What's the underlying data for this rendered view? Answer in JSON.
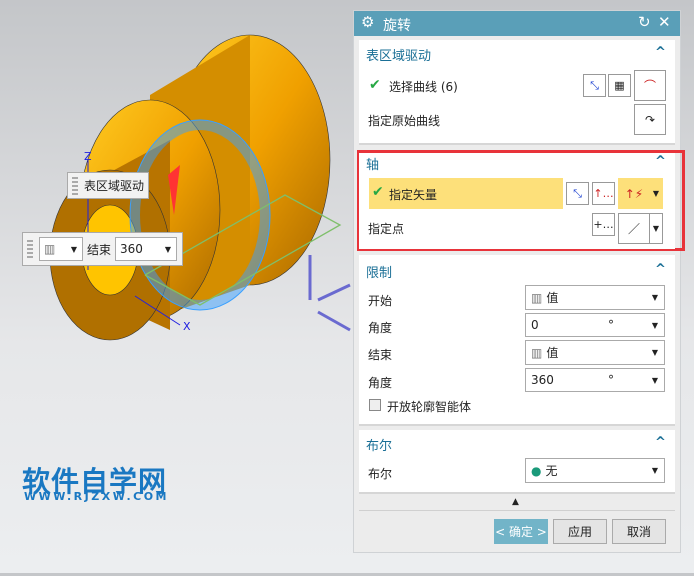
{
  "viewport": {
    "axis_labels": {
      "z": "Z",
      "x": "X"
    },
    "tooltip_label": "表区域驱动",
    "end_toolbar": {
      "label": "结束",
      "value": "360"
    },
    "watermark": {
      "title": "软件自学网",
      "url": "WWW.RJZXW.COM"
    }
  },
  "dialog": {
    "title": "旋转",
    "sections": {
      "region": {
        "title": "表区域驱动",
        "select_curve": "选择曲线 (6)",
        "origin_curve": "指定原始曲线"
      },
      "axis": {
        "title": "轴",
        "vector": "指定矢量",
        "point": "指定点"
      },
      "limits": {
        "title": "限制",
        "start_label": "开始",
        "start_value": "值",
        "angle1_label": "角度",
        "angle1_value": "0",
        "end_label": "结束",
        "end_value": "值",
        "angle2_label": "角度",
        "angle2_value": "360",
        "unit": "°",
        "open_profile": "开放轮廓智能体"
      },
      "boolean": {
        "title": "布尔",
        "label": "布尔",
        "value": "无"
      }
    },
    "buttons": {
      "ok": "< 确定 >",
      "apply": "应用",
      "cancel": "取消"
    }
  },
  "colors": {
    "titlebar": "#5a9fb8",
    "highlight": "#fde07a",
    "accent": "#1a6f96",
    "highlight_border": "#e8333a"
  }
}
